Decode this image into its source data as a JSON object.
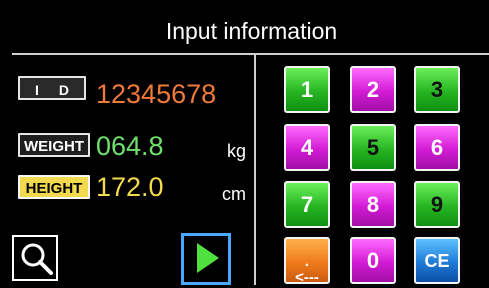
{
  "header": {
    "title": "Input information"
  },
  "fields": {
    "id_label": "I D",
    "id_value": "12345678",
    "weight_label": "WEIGHT",
    "weight_value": "064.8",
    "weight_unit": "kg",
    "height_label": "HEIGHT",
    "height_value": "172.0",
    "height_unit": "cm"
  },
  "keypad": {
    "keys": [
      {
        "label": "1",
        "color": "#26b522"
      },
      {
        "label": "2",
        "color": "#d21bd4"
      },
      {
        "label": "3",
        "color": "#26b522"
      },
      {
        "label": "4",
        "color": "#d21bd4"
      },
      {
        "label": "5",
        "color": "#26b522"
      },
      {
        "label": "6",
        "color": "#d21bd4"
      },
      {
        "label": "7",
        "color": "#26b522"
      },
      {
        "label": "8",
        "color": "#d21bd4"
      },
      {
        "label": "9",
        "color": "#26b522"
      },
      {
        "label": ".\n<---",
        "color": "#f07a1c"
      },
      {
        "label": "0",
        "color": "#d21bd4"
      },
      {
        "label": "CE",
        "color": "#1e7bd7"
      }
    ]
  },
  "icons": {
    "search": "search-icon",
    "play": "play-icon"
  },
  "colors": {
    "background": "#000000",
    "id_value": "#f07a3a",
    "weight_value": "#70e06d",
    "height_value": "#f2d94e",
    "play_border": "#4aa7ff",
    "play_triangle": "#4fe13d"
  }
}
